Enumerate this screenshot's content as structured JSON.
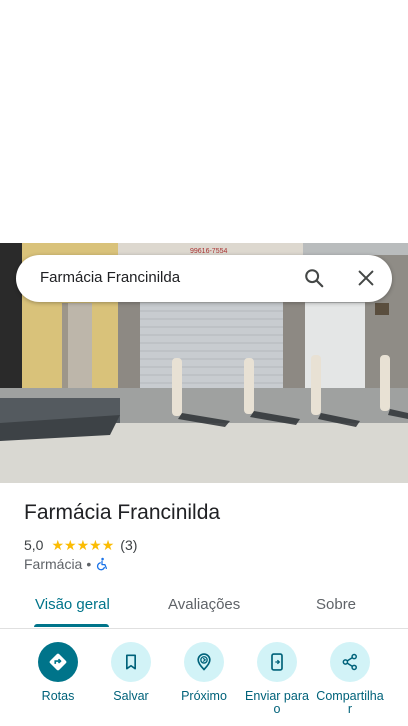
{
  "search": {
    "value": "Farmácia Francinilda"
  },
  "photo": {
    "sign_text": "99616-7554"
  },
  "place": {
    "name": "Farmácia Francinilda",
    "rating": "5,0",
    "stars": 5,
    "review_count": "(3)",
    "category": "Farmácia",
    "separator": "•"
  },
  "tabs": [
    {
      "label": "Visão geral",
      "active": true
    },
    {
      "label": "Avaliações",
      "active": false
    },
    {
      "label": "Sobre",
      "active": false
    }
  ],
  "actions": [
    {
      "label": "Rotas",
      "icon": "directions-icon"
    },
    {
      "label": "Salvar",
      "icon": "bookmark-icon"
    },
    {
      "label": "Próximo",
      "icon": "nearby-icon"
    },
    {
      "label": "Enviar para o",
      "icon": "send-to-phone-icon"
    },
    {
      "label": "Compartilhar",
      "icon": "share-icon"
    }
  ],
  "colors": {
    "accent": "#00748a",
    "action_bg": "#d2f3f7",
    "star": "#fbbc04"
  }
}
